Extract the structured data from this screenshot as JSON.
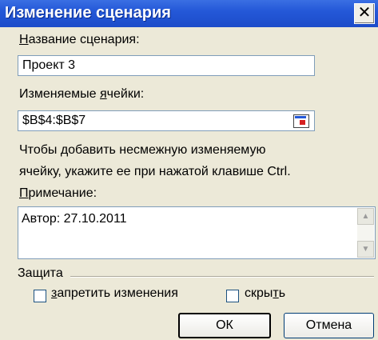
{
  "dialog": {
    "title": "Изменение сценария",
    "close_glyph": "✕"
  },
  "scenario_name": {
    "label_prefix": "",
    "label_access": "Н",
    "label_rest": "азвание сценария:",
    "value": "Проект 3"
  },
  "changing_cells": {
    "label_prefix": "Изменяемые ",
    "label_access": "я",
    "label_rest": "чейки:",
    "value": "$B$4:$B$7"
  },
  "hint": {
    "line1": "Чтобы добавить несмежную изменяемую",
    "line2": "ячейку, укажите ее при нажатой клавише Ctrl."
  },
  "comment": {
    "label_prefix": "",
    "label_access": "П",
    "label_rest": "римечание:",
    "value": "Автор: 27.10.2011"
  },
  "protection": {
    "group_label": "Защита",
    "prevent_changes": {
      "label_prefix": "",
      "label_access": "з",
      "label_rest": "апретить изменения",
      "checked": false
    },
    "hide": {
      "label_prefix": "скры",
      "label_access": "т",
      "label_rest": "ь",
      "checked": false
    }
  },
  "buttons": {
    "ok": "ОК",
    "cancel": "Отмена"
  }
}
